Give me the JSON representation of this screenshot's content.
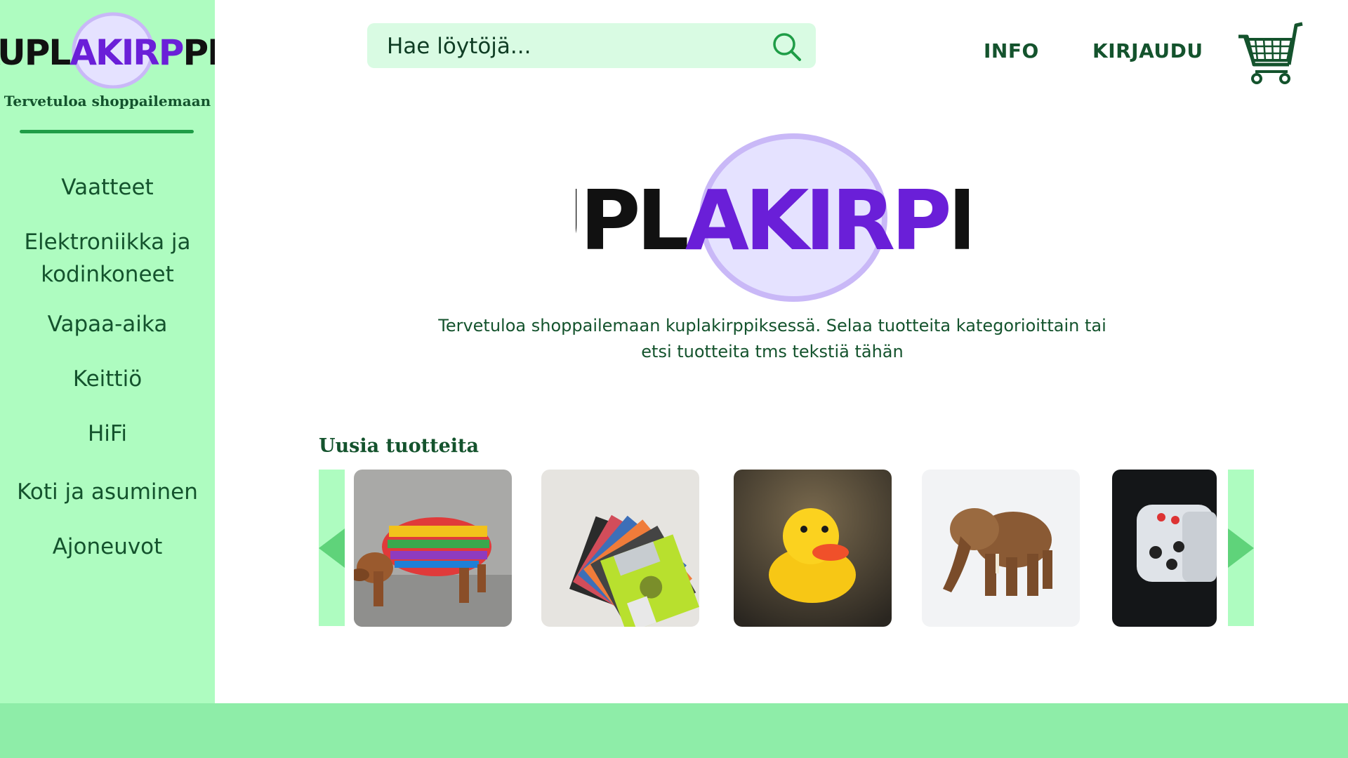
{
  "brand": {
    "logo_text_dark1": "KUPL",
    "logo_text_purple": "AKIRP",
    "logo_text_dark2": "PIS",
    "tagline": "Tervetuloa shoppailemaan",
    "colors": {
      "dark_green": "#14532d",
      "sidebar": "#aefcc0",
      "footer": "#8eeda8",
      "purple": "#6a1fd8",
      "bubble": "#e5e2ff"
    }
  },
  "sidebar": {
    "items": [
      {
        "label": "Vaatteet"
      },
      {
        "label": "Elektroniikka ja"
      },
      {
        "label": "kodinkoneet"
      },
      {
        "label": "Vapaa-aika"
      },
      {
        "label": "Keittiö"
      },
      {
        "label": "HiFi"
      },
      {
        "label": "Koti ja asuminen"
      },
      {
        "label": "Ajoneuvot"
      }
    ]
  },
  "header": {
    "search": {
      "placeholder": "Hae löytöjä...",
      "value": "",
      "icon": "search-icon"
    },
    "info_label": "INFO",
    "login_label": "KIRJAUDU",
    "cart_icon": "cart-icon"
  },
  "hero": {
    "text": "Tervetuloa shoppailemaan kuplakirppiksessä. Selaa tuotteita kategorioittain tai etsi tuotteita tms tekstiä tähän"
  },
  "new_products": {
    "title": "Uusia tuotteita",
    "items": [
      {
        "subject": "dog in knitted sweater"
      },
      {
        "subject": "floppy disks"
      },
      {
        "subject": "rubber duck"
      },
      {
        "subject": "wooden elephant"
      },
      {
        "subject": "dice"
      }
    ],
    "prev_icon": "chevron-left-icon",
    "next_icon": "chevron-right-icon"
  }
}
